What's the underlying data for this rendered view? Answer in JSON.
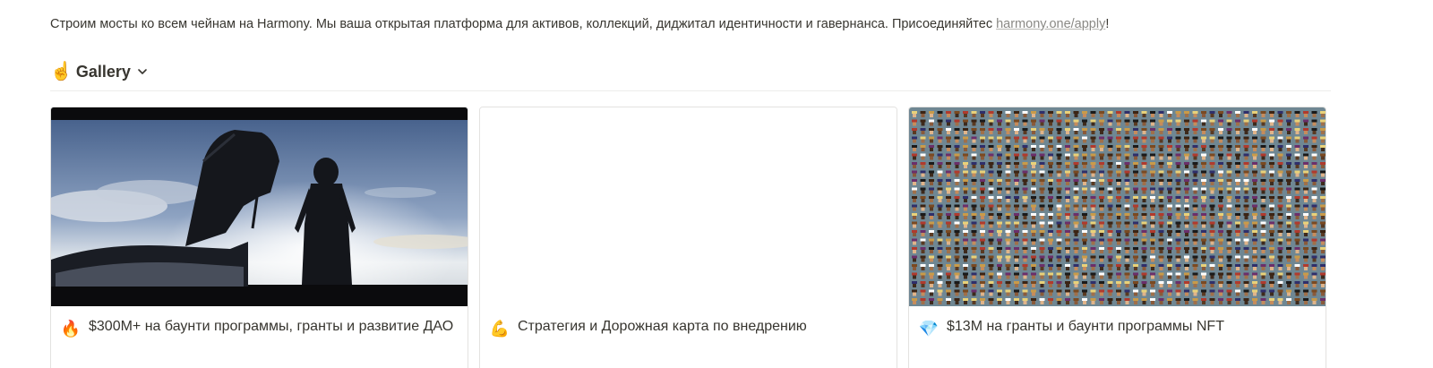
{
  "intro": {
    "text": "Строим мосты ко всем чейнам на Harmony. Мы ваша открытая платформа для активов, коллекций, диджитал идентичности и гавернанса. Присоединяйтес ",
    "link_text": "harmony.one/apply",
    "suffix": "!"
  },
  "gallery": {
    "icon": "pointing-hand-icon",
    "icon_glyph": "☝",
    "title": "Gallery",
    "toggle_icon": "chevron-down-icon"
  },
  "cards": [
    {
      "emoji": "🔥",
      "emoji_name": "fire-icon",
      "title": "$300M+ на баунти программы, гранты и развитие ДАО",
      "cover": "silhouette-car-photo"
    },
    {
      "emoji": "💪",
      "emoji_name": "flexed-biceps-icon",
      "title": "Стратегия и Дорожная карта по внедрению",
      "cover": "none"
    },
    {
      "emoji": "💎",
      "emoji_name": "gem-icon",
      "title": "$13M на гранты и баунти программы NFT",
      "cover": "pixel-avatar-mosaic"
    }
  ],
  "colors": {
    "text": "#37352f",
    "link": "#8a8985",
    "border": "#e3e2e0",
    "mosaic_bg": "#6f8793"
  }
}
